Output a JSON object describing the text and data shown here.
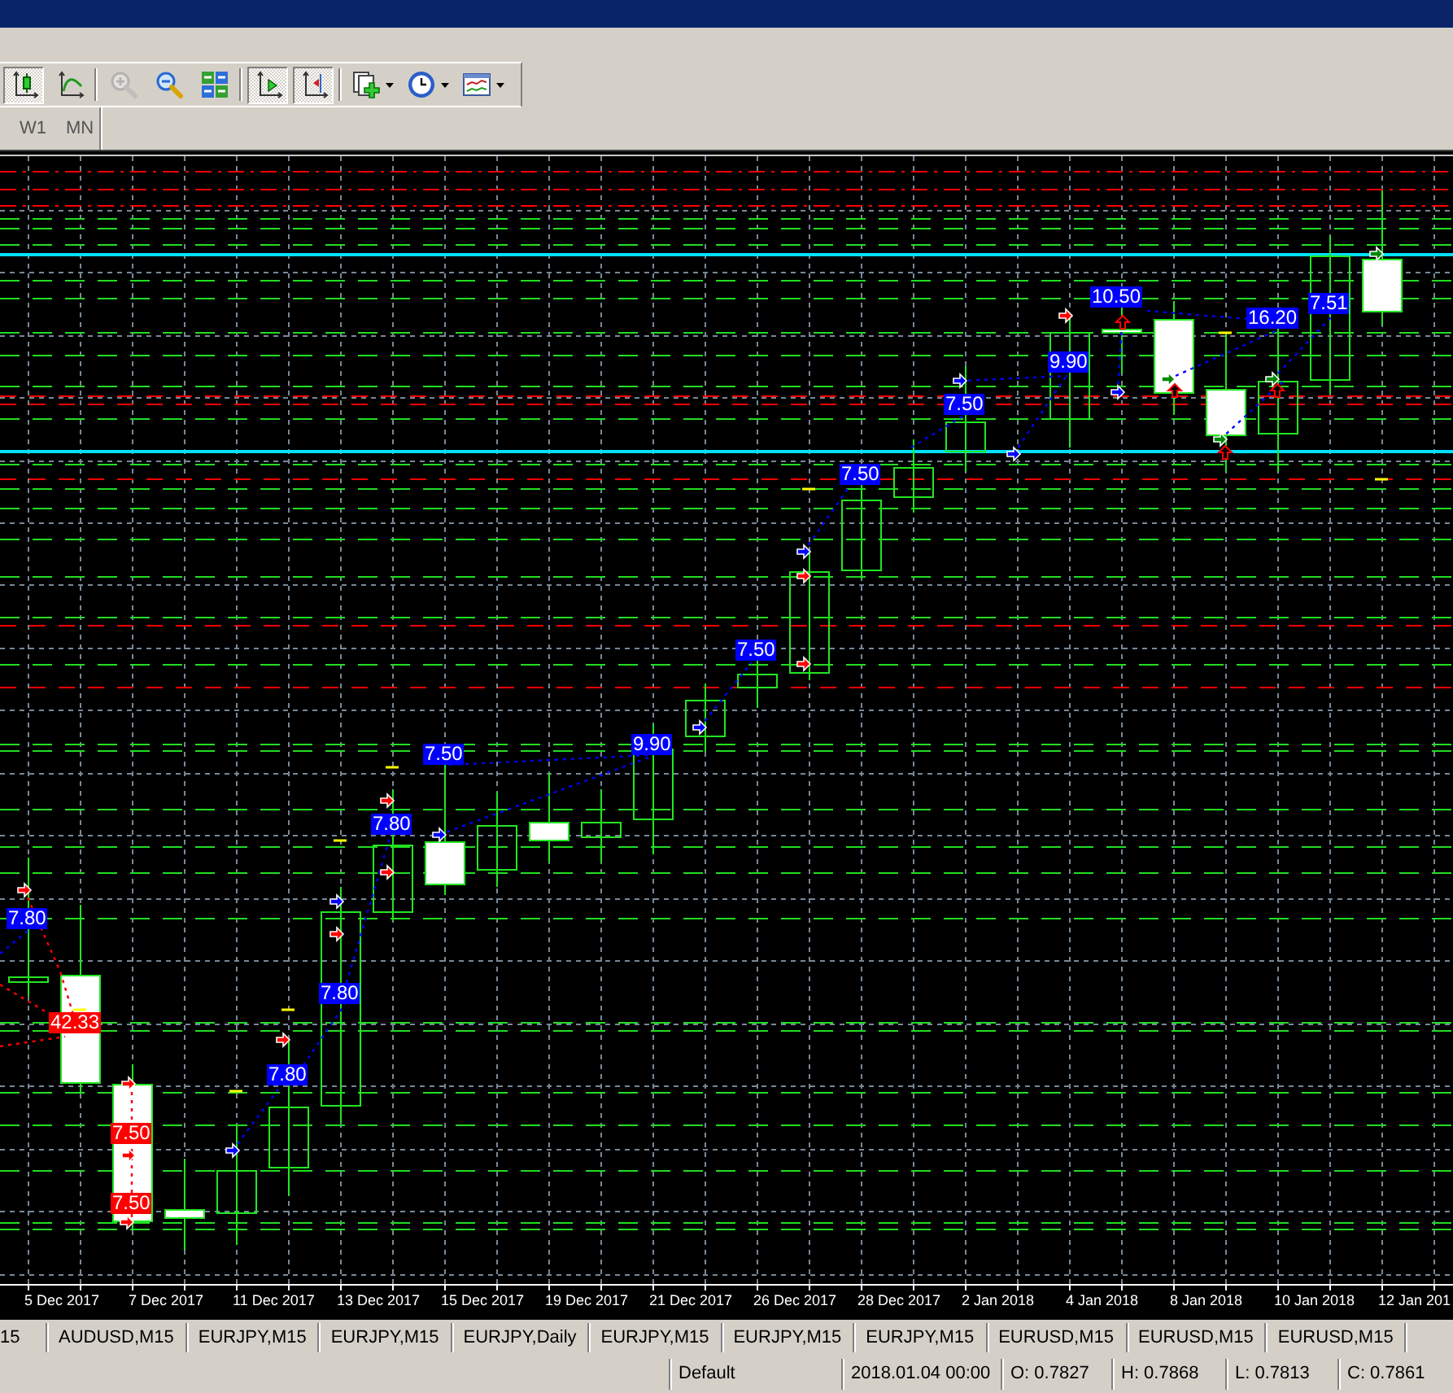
{
  "toolbar": {
    "groups": [
      [
        {
          "kind": "button",
          "pressed": true,
          "disabled": false
        },
        {
          "kind": "button",
          "pressed": false,
          "disabled": false
        }
      ],
      [
        {
          "kind": "button",
          "pressed": false,
          "disabled": true
        },
        {
          "kind": "button",
          "pressed": false,
          "disabled": false
        },
        {
          "kind": "button",
          "pressed": false,
          "disabled": false
        }
      ],
      [
        {
          "kind": "button",
          "pressed": true,
          "disabled": false
        },
        {
          "kind": "button",
          "pressed": true,
          "disabled": false
        }
      ],
      [
        {
          "kind": "dropdown",
          "pressed": false,
          "disabled": false
        },
        {
          "kind": "dropdown",
          "pressed": false,
          "disabled": false
        },
        {
          "kind": "dropdown",
          "pressed": false,
          "disabled": false
        }
      ]
    ]
  },
  "timeframes": [
    {
      "label": "W1",
      "selected": false
    },
    {
      "label": "MN",
      "selected": false
    }
  ],
  "chart": {
    "trade_labels": [
      {
        "text": "7.80",
        "color": "#0000ff"
      },
      {
        "text": "42.33",
        "color": "#ff0000"
      },
      {
        "text": "7.50",
        "color": "#ff0000"
      },
      {
        "text": "7.50",
        "color": "#ff0000"
      },
      {
        "text": "7.80",
        "color": "#0000ff"
      },
      {
        "text": "7.80",
        "color": "#0000ff"
      },
      {
        "text": "7.80",
        "color": "#0000ff"
      },
      {
        "text": "7.50",
        "color": "#0000ff"
      },
      {
        "text": "9.90",
        "color": "#0000ff"
      },
      {
        "text": "7.50",
        "color": "#0000ff"
      },
      {
        "text": "7.50",
        "color": "#0000ff"
      },
      {
        "text": "7.50",
        "color": "#0000ff"
      },
      {
        "text": "9.90",
        "color": "#0000ff"
      },
      {
        "text": "10.50",
        "color": "#0000ff"
      },
      {
        "text": "16.20",
        "color": "#0000ff"
      },
      {
        "text": "7.51",
        "color": "#0000ff"
      }
    ],
    "date_labels": [
      "5 Dec 2017",
      "7 Dec 2017",
      "11 Dec 2017",
      "13 Dec 2017",
      "15 Dec 2017",
      "19 Dec 2017",
      "21 Dec 2017",
      "26 Dec 2017",
      "28 Dec 2017",
      "2 Jan 2018",
      "4 Jan 2018",
      "8 Jan 2018",
      "10 Jan 2018",
      "12 Jan 201"
    ]
  },
  "tabs": [
    {
      "label": "15",
      "selected": false
    },
    {
      "label": "AUDUSD,M15",
      "selected": false
    },
    {
      "label": "EURJPY,M15",
      "selected": false
    },
    {
      "label": "EURJPY,M15",
      "selected": false
    },
    {
      "label": "EURJPY,Daily",
      "selected": false
    },
    {
      "label": "EURJPY,M15",
      "selected": false
    },
    {
      "label": "EURJPY,M15",
      "selected": false
    },
    {
      "label": "EURJPY,M15",
      "selected": false
    },
    {
      "label": "EURUSD,M15",
      "selected": false
    },
    {
      "label": "EURUSD,M15",
      "selected": false
    },
    {
      "label": "EURUSD,M15",
      "selected": false
    }
  ],
  "status_bar": {
    "profile": "Default",
    "time": "2018.01.04 00:00",
    "open": "O: 0.7827",
    "high": "H: 0.7868",
    "low": "L: 0.7813",
    "close": "C: 0.7861"
  }
}
